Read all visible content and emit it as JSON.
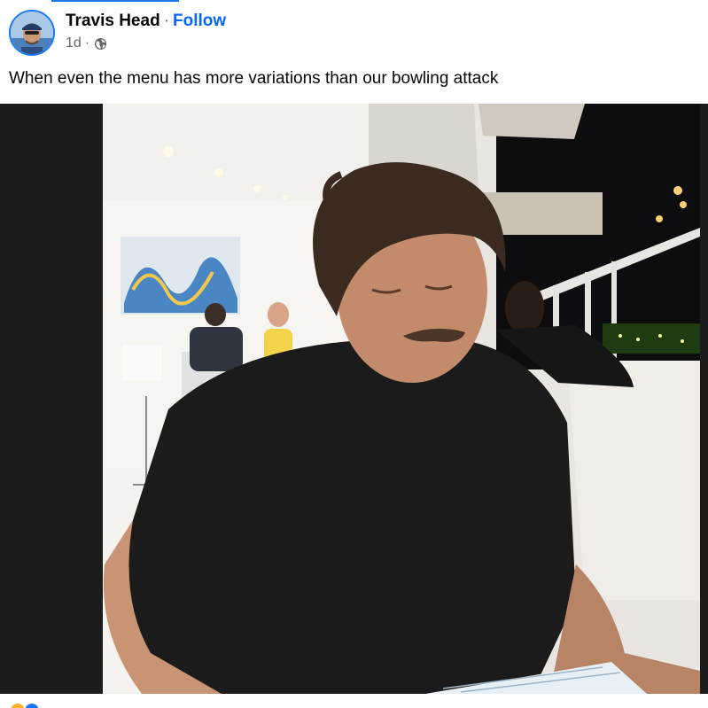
{
  "post": {
    "author": "Travis Head",
    "separator": "·",
    "follow_label": "Follow",
    "timestamp": "1d",
    "meta_separator": "·",
    "audience_icon": "globe-icon",
    "caption": "When even the menu has more variations than our bowling attack",
    "media": {
      "type": "photo",
      "subject": "man in black t-shirt reading a menu at a restaurant table at night"
    },
    "reactions": {
      "icons": [
        "haha-reaction-icon",
        "like-reaction-icon"
      ],
      "summary": ""
    }
  },
  "colors": {
    "accent": "#1877f2",
    "follow": "#0866ff",
    "text": "#050505",
    "secondary_text": "#65676b",
    "media_letterbox": "#1c1c1c"
  }
}
